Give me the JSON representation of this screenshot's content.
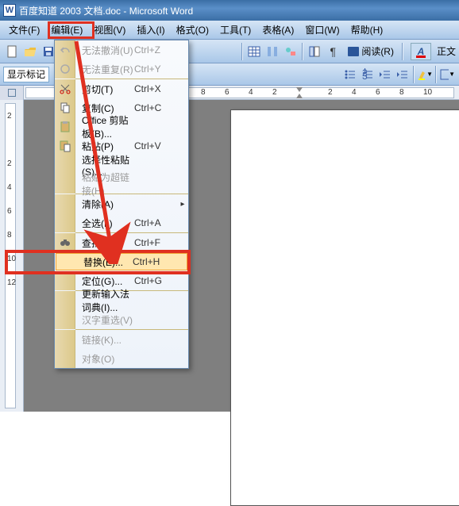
{
  "title": "百度知道 2003 文档.doc - Microsoft Word",
  "w_icon_letter": "W",
  "menubar": {
    "file": "文件(F)",
    "edit": "编辑(E)",
    "view": "视图(V)",
    "insert": "插入(I)",
    "format": "格式(O)",
    "tools": "工具(T)",
    "table": "表格(A)",
    "window": "窗口(W)",
    "help": "帮助(H)"
  },
  "toolbar": {
    "style_label": "显示标记",
    "reading_label": "阅读(R)",
    "aa": "A",
    "body_text": "正文"
  },
  "dropdown": {
    "undo": "无法撤消(U)",
    "undo_sc": "Ctrl+Z",
    "redo": "无法重复(R)",
    "redo_sc": "Ctrl+Y",
    "cut": "剪切(T)",
    "cut_sc": "Ctrl+X",
    "copy": "复制(C)",
    "copy_sc": "Ctrl+C",
    "office_clip": "Office 剪贴板(B)...",
    "paste": "粘贴(P)",
    "paste_sc": "Ctrl+V",
    "paste_special": "选择性粘贴(S)...",
    "paste_link": "粘贴为超链接(H)",
    "clear": "清除(A)",
    "select_all": "全选(L)",
    "select_all_sc": "Ctrl+A",
    "find": "查找(F)...",
    "find_sc": "Ctrl+F",
    "replace": "替换(E)...",
    "replace_sc": "Ctrl+H",
    "goto": "定位(G)...",
    "goto_sc": "Ctrl+G",
    "ime_dict": "更新输入法词典(I)...",
    "hanzi": "汉字重选(V)",
    "links": "链接(K)...",
    "object": "对象(O)"
  },
  "ruler_h": [
    "8",
    "6",
    "4",
    "2",
    "2",
    "4",
    "6",
    "8",
    "10"
  ],
  "ruler_v": [
    "2",
    "2",
    "4",
    "6",
    "8",
    "10",
    "12"
  ]
}
